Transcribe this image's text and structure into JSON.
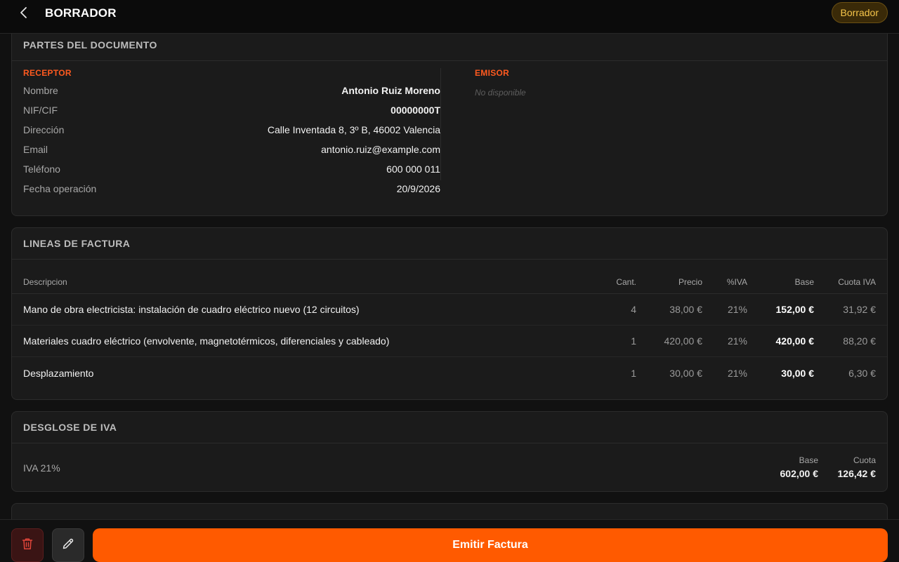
{
  "header": {
    "title": "BORRADOR",
    "status_badge": "Borrador"
  },
  "parties": {
    "title": "PARTES DEL DOCUMENTO",
    "receptor": {
      "label": "RECEPTOR",
      "fields": [
        {
          "key": "Nombre",
          "value": "Antonio Ruiz Moreno"
        },
        {
          "key": "NIF/CIF",
          "value": "00000000T"
        },
        {
          "key": "Dirección",
          "value": "Calle Inventada 8, 3º B, 46002 Valencia"
        },
        {
          "key": "Email",
          "value": "antonio.ruiz@example.com"
        },
        {
          "key": "Teléfono",
          "value": "600 000 011"
        },
        {
          "key": "Fecha operación",
          "value": "20/9/2026"
        }
      ]
    },
    "emisor": {
      "label": "EMISOR",
      "empty_text": "No disponible"
    }
  },
  "lines": {
    "title": "LINEAS DE FACTURA",
    "columns": {
      "desc": "Descripcion",
      "cant": "Cant.",
      "precio": "Precio",
      "iva": "%IVA",
      "base": "Base",
      "cuota": "Cuota IVA"
    },
    "rows": [
      {
        "desc": "Mano de obra electricista: instalación de cuadro eléctrico nuevo (12 circuitos)",
        "cant": "4",
        "precio": "38,00 €",
        "iva": "21%",
        "base": "152,00 €",
        "cuota": "31,92 €"
      },
      {
        "desc": "Materiales cuadro eléctrico (envolvente, magnetotérmicos, diferenciales y cableado)",
        "cant": "1",
        "precio": "420,00 €",
        "iva": "21%",
        "base": "420,00 €",
        "cuota": "88,20 €"
      },
      {
        "desc": "Desplazamiento",
        "cant": "1",
        "precio": "30,00 €",
        "iva": "21%",
        "base": "30,00 €",
        "cuota": "6,30 €"
      }
    ]
  },
  "vat": {
    "title": "DESGLOSE DE IVA",
    "label": "IVA 21%",
    "base_header": "Base",
    "base_value": "602,00 €",
    "cuota_header": "Cuota",
    "cuota_value": "126,42 €"
  },
  "footer": {
    "emit_label": "Emitir Factura"
  },
  "icons": {
    "back": "chevron-left-icon",
    "delete": "trash-icon",
    "edit": "pencil-icon"
  },
  "colors": {
    "accent": "#ff5a00",
    "section_label": "#ff5a1f",
    "badge_text": "#f6c54a",
    "badge_bg": "#3a2a08",
    "delete_icon": "#e0453a"
  }
}
